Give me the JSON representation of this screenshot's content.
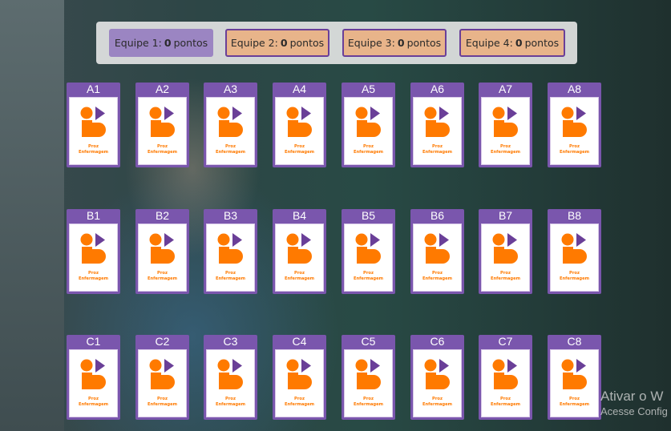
{
  "scoreboard": {
    "teams": [
      {
        "label": "Equipe 1:",
        "score": "0",
        "unit": "pontos",
        "active": true
      },
      {
        "label": "Equipe 2:",
        "score": "0",
        "unit": "pontos",
        "active": false
      },
      {
        "label": "Equipe 3:",
        "score": "0",
        "unit": "pontos",
        "active": false
      },
      {
        "label": "Equipe 4:",
        "score": "0",
        "unit": "pontos",
        "active": false
      }
    ]
  },
  "board": {
    "rows": [
      [
        "A1",
        "A2",
        "A3",
        "A4",
        "A5",
        "A6",
        "A7",
        "A8"
      ],
      [
        "B1",
        "B2",
        "B3",
        "B4",
        "B5",
        "B6",
        "B7",
        "B8"
      ],
      [
        "C1",
        "C2",
        "C3",
        "C4",
        "C5",
        "C6",
        "C7",
        "C8"
      ]
    ],
    "card_logo_text_line1": "Proz",
    "card_logo_text_line2": "Enfermagem"
  },
  "colors": {
    "card_header": "#7a56ad",
    "logo_orange": "#ff7a00",
    "logo_purple": "#6a3f98",
    "active_team": "#9b85c2",
    "idle_team": "#e8b48a"
  },
  "watermark": {
    "line1": "Ativar o W",
    "line2": "Acesse Config"
  }
}
